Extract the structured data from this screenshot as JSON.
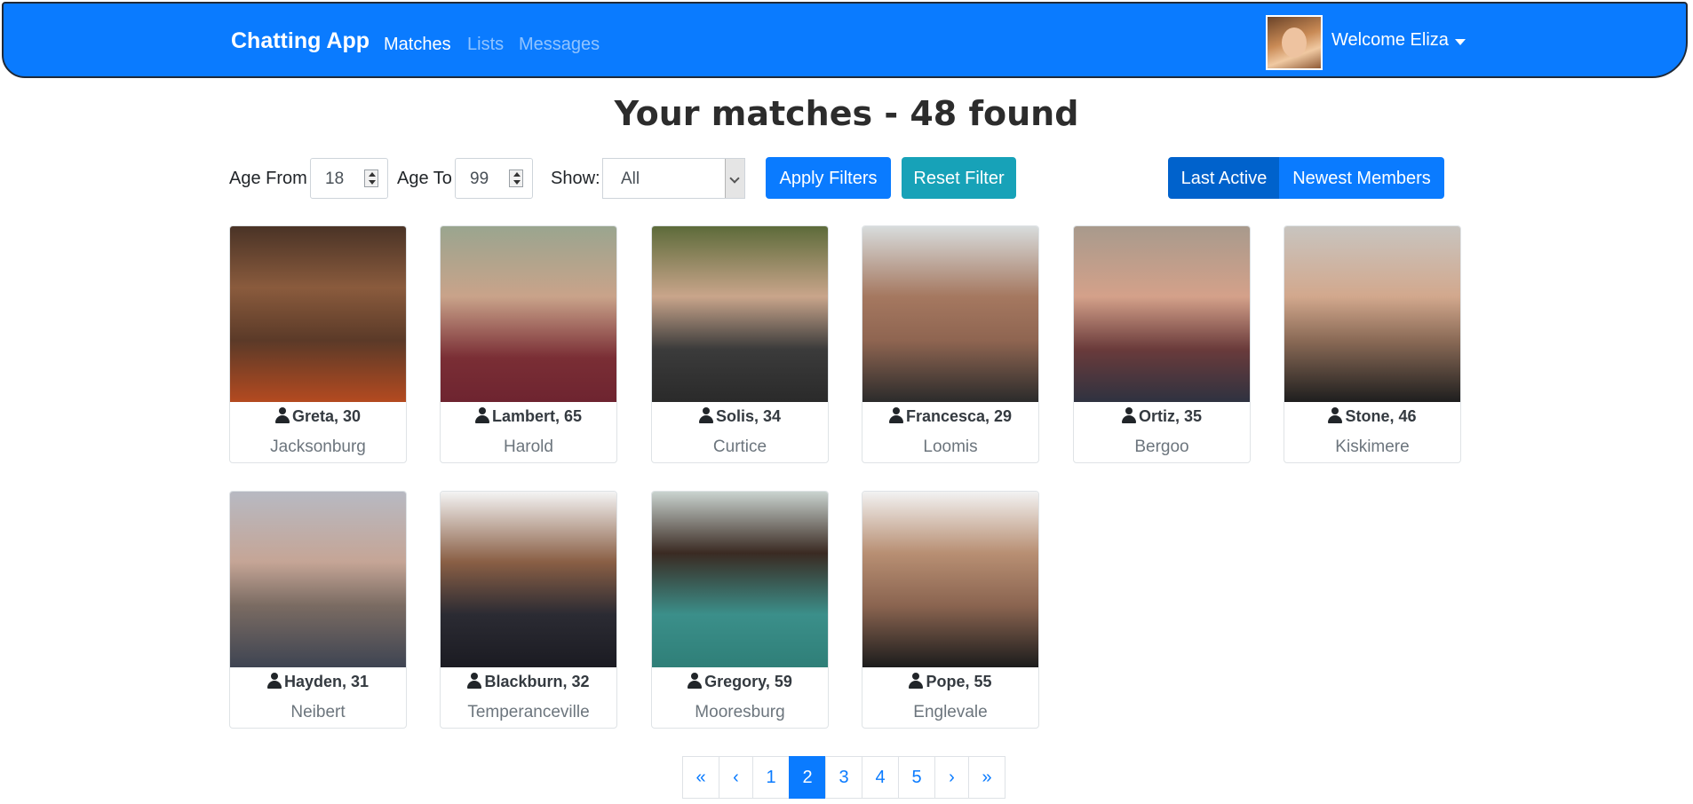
{
  "navbar": {
    "brand": "Chatting App",
    "links": [
      "Matches",
      "Lists",
      "Messages"
    ],
    "welcome": "Welcome Eliza"
  },
  "title": "Your matches - 48 found",
  "filters": {
    "age_from_label": "Age From",
    "age_from_value": "18",
    "age_to_label": "Age To",
    "age_to_value": "99",
    "show_label": "Show:",
    "show_value": "All",
    "apply_label": "Apply Filters",
    "reset_label": "Reset Filter",
    "sort_last_active": "Last Active",
    "sort_newest": "Newest Members"
  },
  "members": [
    {
      "name": "Greta, 30",
      "city": "Jacksonburg"
    },
    {
      "name": "Lambert, 65",
      "city": "Harold"
    },
    {
      "name": "Solis, 34",
      "city": "Curtice"
    },
    {
      "name": "Francesca, 29",
      "city": "Loomis"
    },
    {
      "name": "Ortiz, 35",
      "city": "Bergoo"
    },
    {
      "name": "Stone, 46",
      "city": "Kiskimere"
    },
    {
      "name": "Hayden, 31",
      "city": "Neibert"
    },
    {
      "name": "Blackburn, 32",
      "city": "Temperanceville"
    },
    {
      "name": "Gregory, 59",
      "city": "Mooresburg"
    },
    {
      "name": "Pope, 55",
      "city": "Englevale"
    }
  ],
  "pagination": [
    "«",
    "‹",
    "1",
    "2",
    "3",
    "4",
    "5",
    "›",
    "»"
  ],
  "active_page": "2",
  "colors": {
    "primary": "#0a7bff",
    "info": "#17a2b8"
  }
}
